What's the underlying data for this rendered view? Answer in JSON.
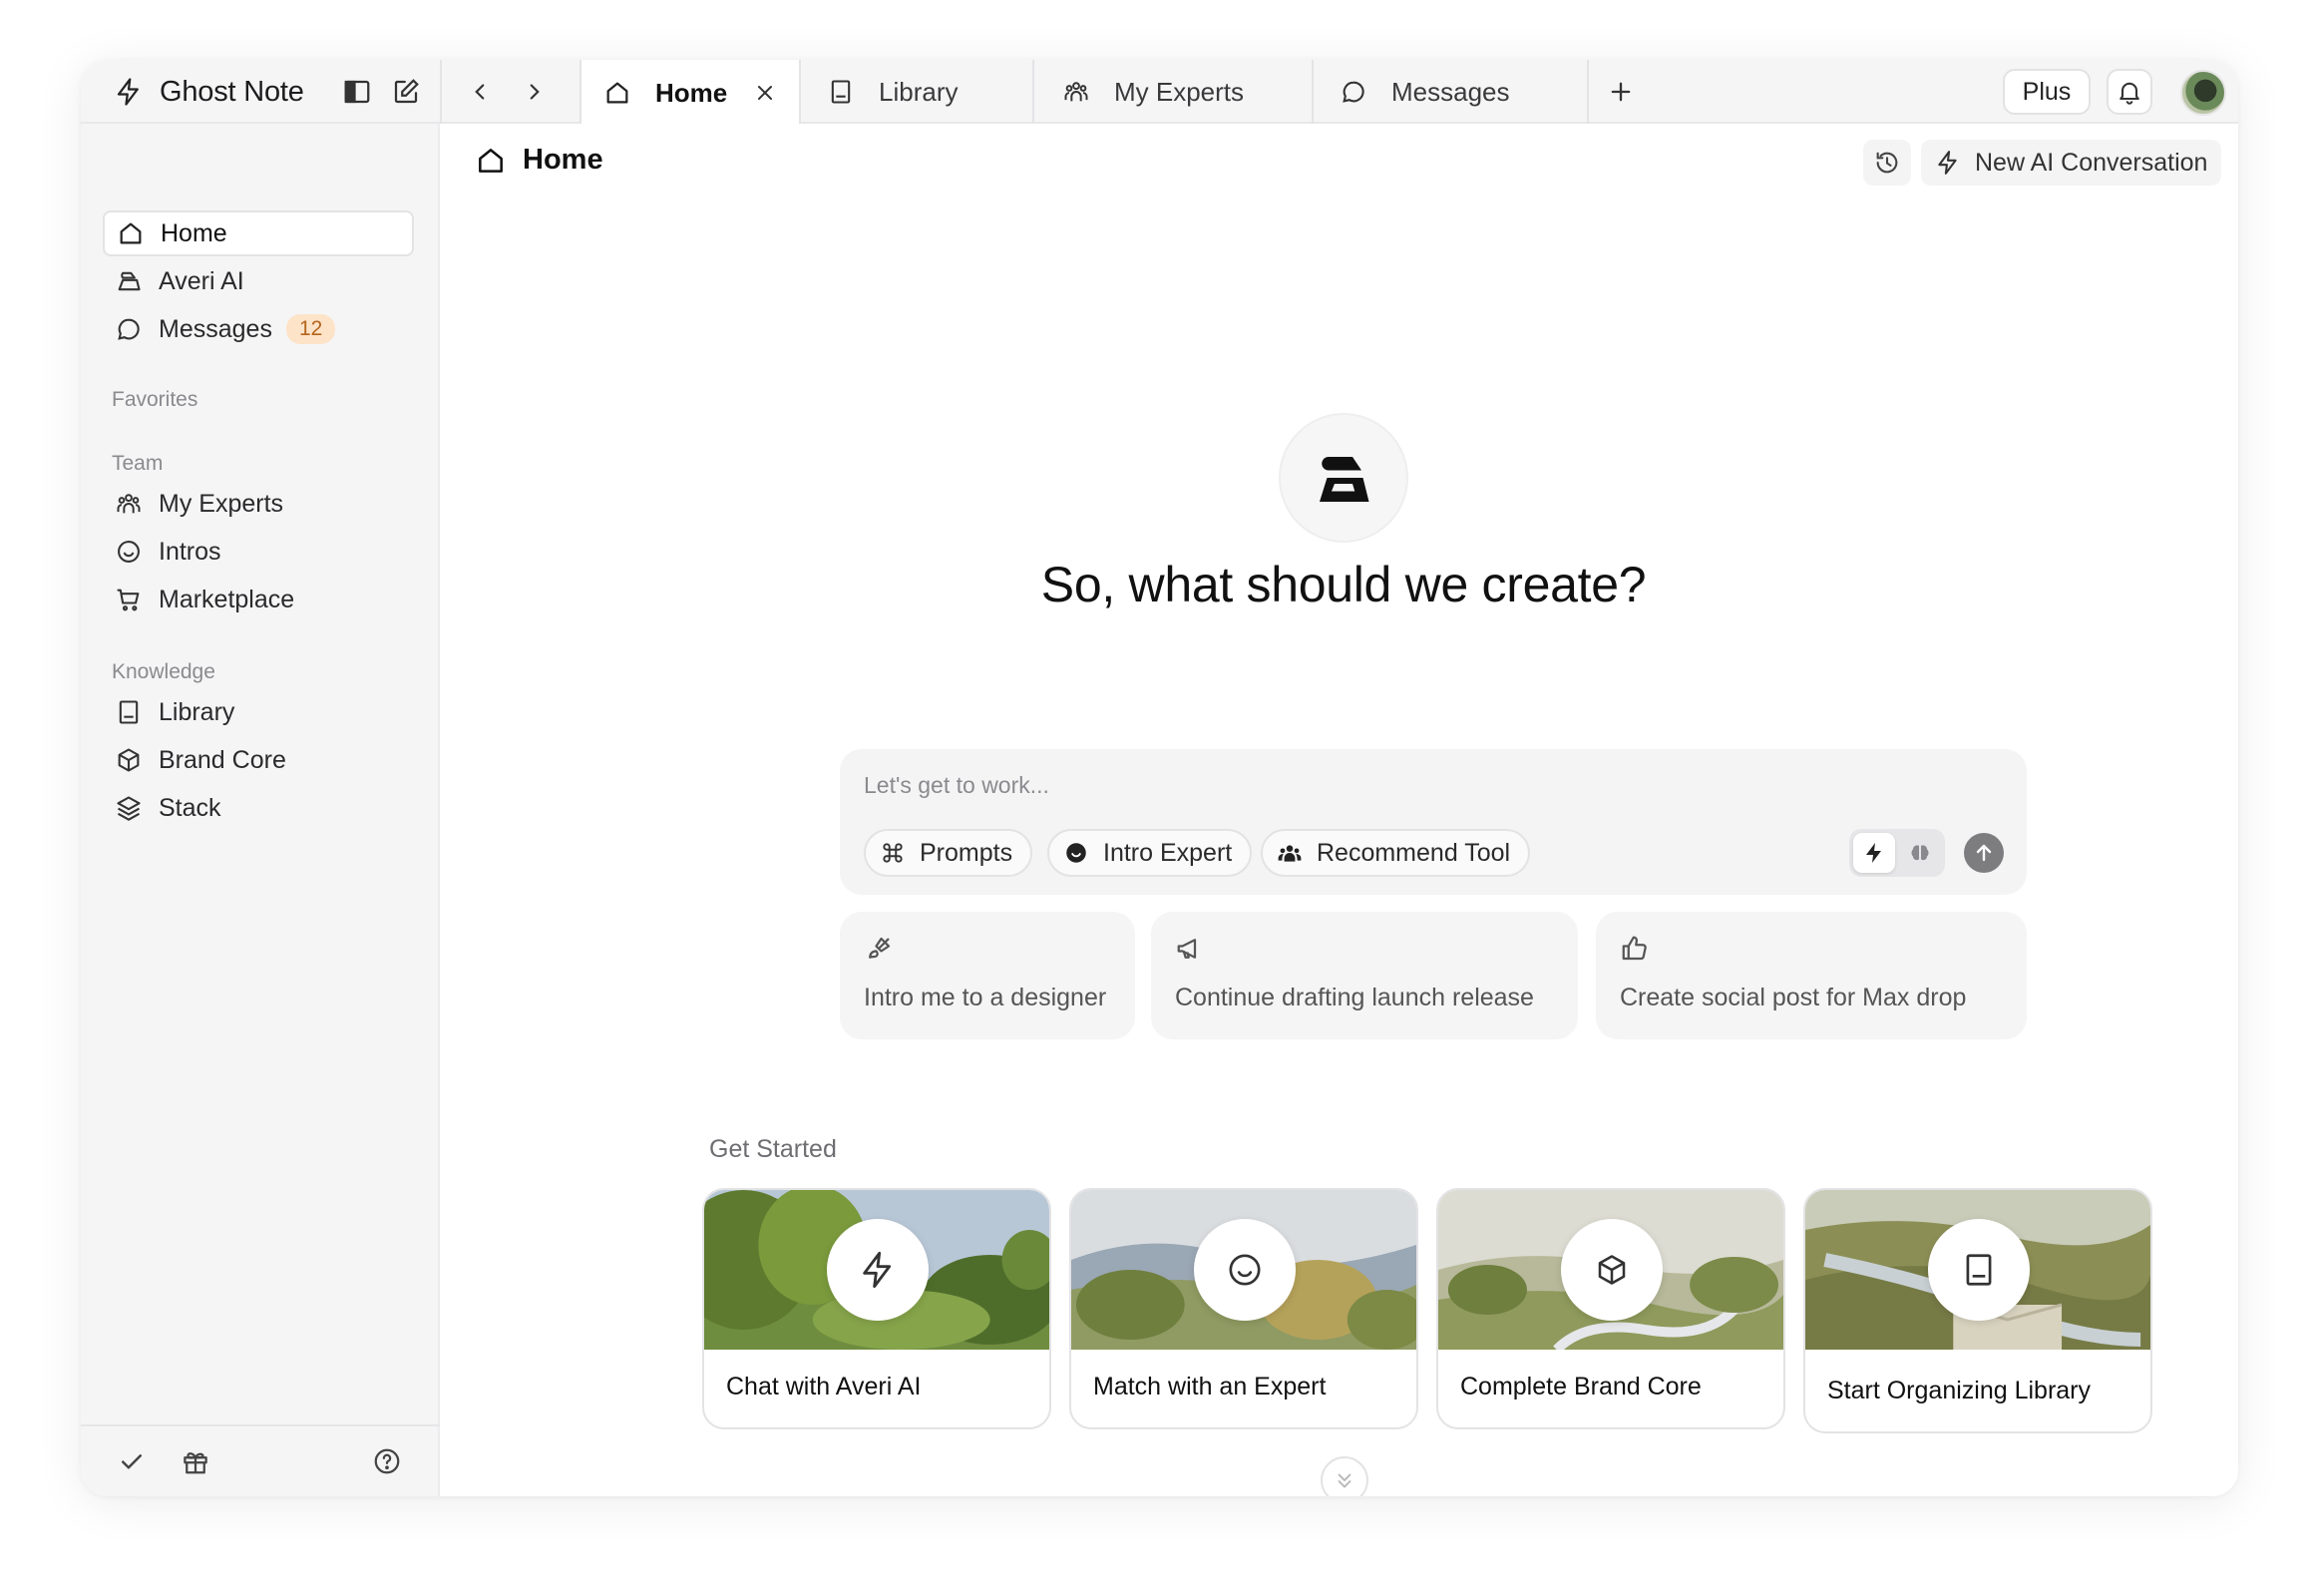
{
  "app": {
    "name": "Ghost Note"
  },
  "tabs": [
    {
      "label": "Home",
      "icon": "home-icon",
      "active": true
    },
    {
      "label": "Library",
      "icon": "library-icon",
      "active": false
    },
    {
      "label": "My Experts",
      "icon": "people-icon",
      "active": false
    },
    {
      "label": "Messages",
      "icon": "chat-bubble-icon",
      "active": false
    }
  ],
  "header": {
    "plus_label": "Plus"
  },
  "sidebar": {
    "top_items": [
      {
        "label": "Home",
        "icon": "home-icon",
        "active": true
      },
      {
        "label": "Averi AI",
        "icon": "averi-icon"
      },
      {
        "label": "Messages",
        "icon": "chat-bubble-icon",
        "badge": "12"
      }
    ],
    "favorites_label": "Favorites",
    "team_label": "Team",
    "team_items": [
      {
        "label": "My Experts",
        "icon": "people-icon"
      },
      {
        "label": "Intros",
        "icon": "smile-icon"
      },
      {
        "label": "Marketplace",
        "icon": "cart-icon"
      }
    ],
    "knowledge_label": "Knowledge",
    "knowledge_items": [
      {
        "label": "Library",
        "icon": "library-icon"
      },
      {
        "label": "Brand Core",
        "icon": "cube-icon"
      },
      {
        "label": "Stack",
        "icon": "layers-icon"
      }
    ]
  },
  "main": {
    "title": "Home",
    "new_conversation_label": "New AI Conversation",
    "hero_title": "So, what should we create?",
    "composer": {
      "placeholder": "Let's get to work...",
      "chips": [
        {
          "label": "Prompts",
          "icon": "command-icon"
        },
        {
          "label": "Intro Expert",
          "icon": "smile-filled-icon"
        },
        {
          "label": "Recommend Tool",
          "icon": "team-icon"
        }
      ]
    },
    "suggestions": [
      {
        "label": "Intro me to a designer",
        "icon": "brush-icon"
      },
      {
        "label": "Continue drafting launch release",
        "icon": "megaphone-icon"
      },
      {
        "label": "Create social post for Max drop",
        "icon": "thumbs-up-icon"
      }
    ],
    "get_started_label": "Get Started",
    "cards": [
      {
        "label": "Chat with Averi AI",
        "icon": "bolt-icon"
      },
      {
        "label": "Match with an Expert",
        "icon": "smile-icon"
      },
      {
        "label": "Complete Brand Core",
        "icon": "cube-icon"
      },
      {
        "label": "Start Organizing Library",
        "icon": "library-icon"
      }
    ]
  },
  "colors": {
    "badge_bg": "#fde3c8",
    "badge_text": "#b5651d",
    "sidebar_bg": "#f5f5f6",
    "composer_bg": "#f4f4f5"
  }
}
